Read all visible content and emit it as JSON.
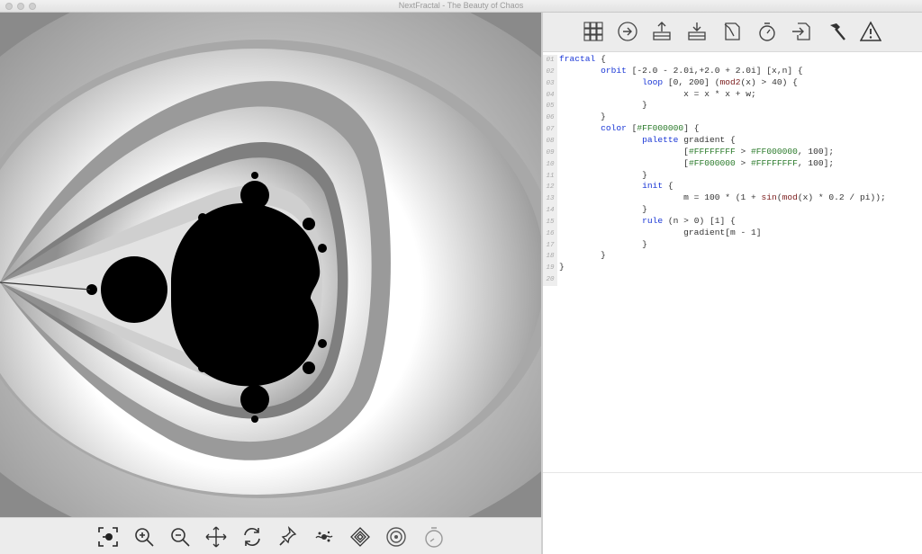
{
  "window": {
    "title": "NextFractal - The Beauty of Chaos"
  },
  "bottom_toolbar": {
    "icons": [
      "select-zoom-icon",
      "zoom-in-icon",
      "zoom-out-icon",
      "move-icon",
      "rotate-icon",
      "pin-icon",
      "julia-icon",
      "orbit-icon",
      "capture-icon",
      "timer-icon"
    ]
  },
  "top_toolbar": {
    "icons": [
      "grid-icon",
      "play-icon",
      "upload-icon",
      "download-icon",
      "edit-file-icon",
      "stopwatch-icon",
      "export-icon",
      "hammer-icon",
      "warning-icon"
    ]
  },
  "editor": {
    "lines": [
      {
        "n": "01",
        "text": "fractal {"
      },
      {
        "n": "02",
        "text": "        orbit [-2.0 - 2.0i,+2.0 + 2.0i] [x,n] {"
      },
      {
        "n": "03",
        "text": "                loop [0, 200] (mod2(x) > 40) {"
      },
      {
        "n": "04",
        "text": "                        x = x * x + w;"
      },
      {
        "n": "05",
        "text": "                }"
      },
      {
        "n": "06",
        "text": "        }"
      },
      {
        "n": "07",
        "text": "        color [#FF000000] {"
      },
      {
        "n": "08",
        "text": "                palette gradient {"
      },
      {
        "n": "09",
        "text": "                        [#FFFFFFFF > #FF000000, 100];"
      },
      {
        "n": "10",
        "text": "                        [#FF000000 > #FFFFFFFF, 100];"
      },
      {
        "n": "11",
        "text": "                }"
      },
      {
        "n": "12",
        "text": "                init {"
      },
      {
        "n": "13",
        "text": "                        m = 100 * (1 + sin(mod(x) * 0.2 / pi));"
      },
      {
        "n": "14",
        "text": "                }"
      },
      {
        "n": "15",
        "text": "                rule (n > 0) [1] {"
      },
      {
        "n": "16",
        "text": "                        gradient[m - 1]"
      },
      {
        "n": "17",
        "text": "                }"
      },
      {
        "n": "18",
        "text": "        }"
      },
      {
        "n": "19",
        "text": "}"
      },
      {
        "n": "20",
        "text": ""
      }
    ]
  },
  "colors": {
    "keyword": "#1a37d6",
    "bracket": "#b03a10",
    "hex": "#2a7a2a",
    "function": "#7a1b1b"
  }
}
